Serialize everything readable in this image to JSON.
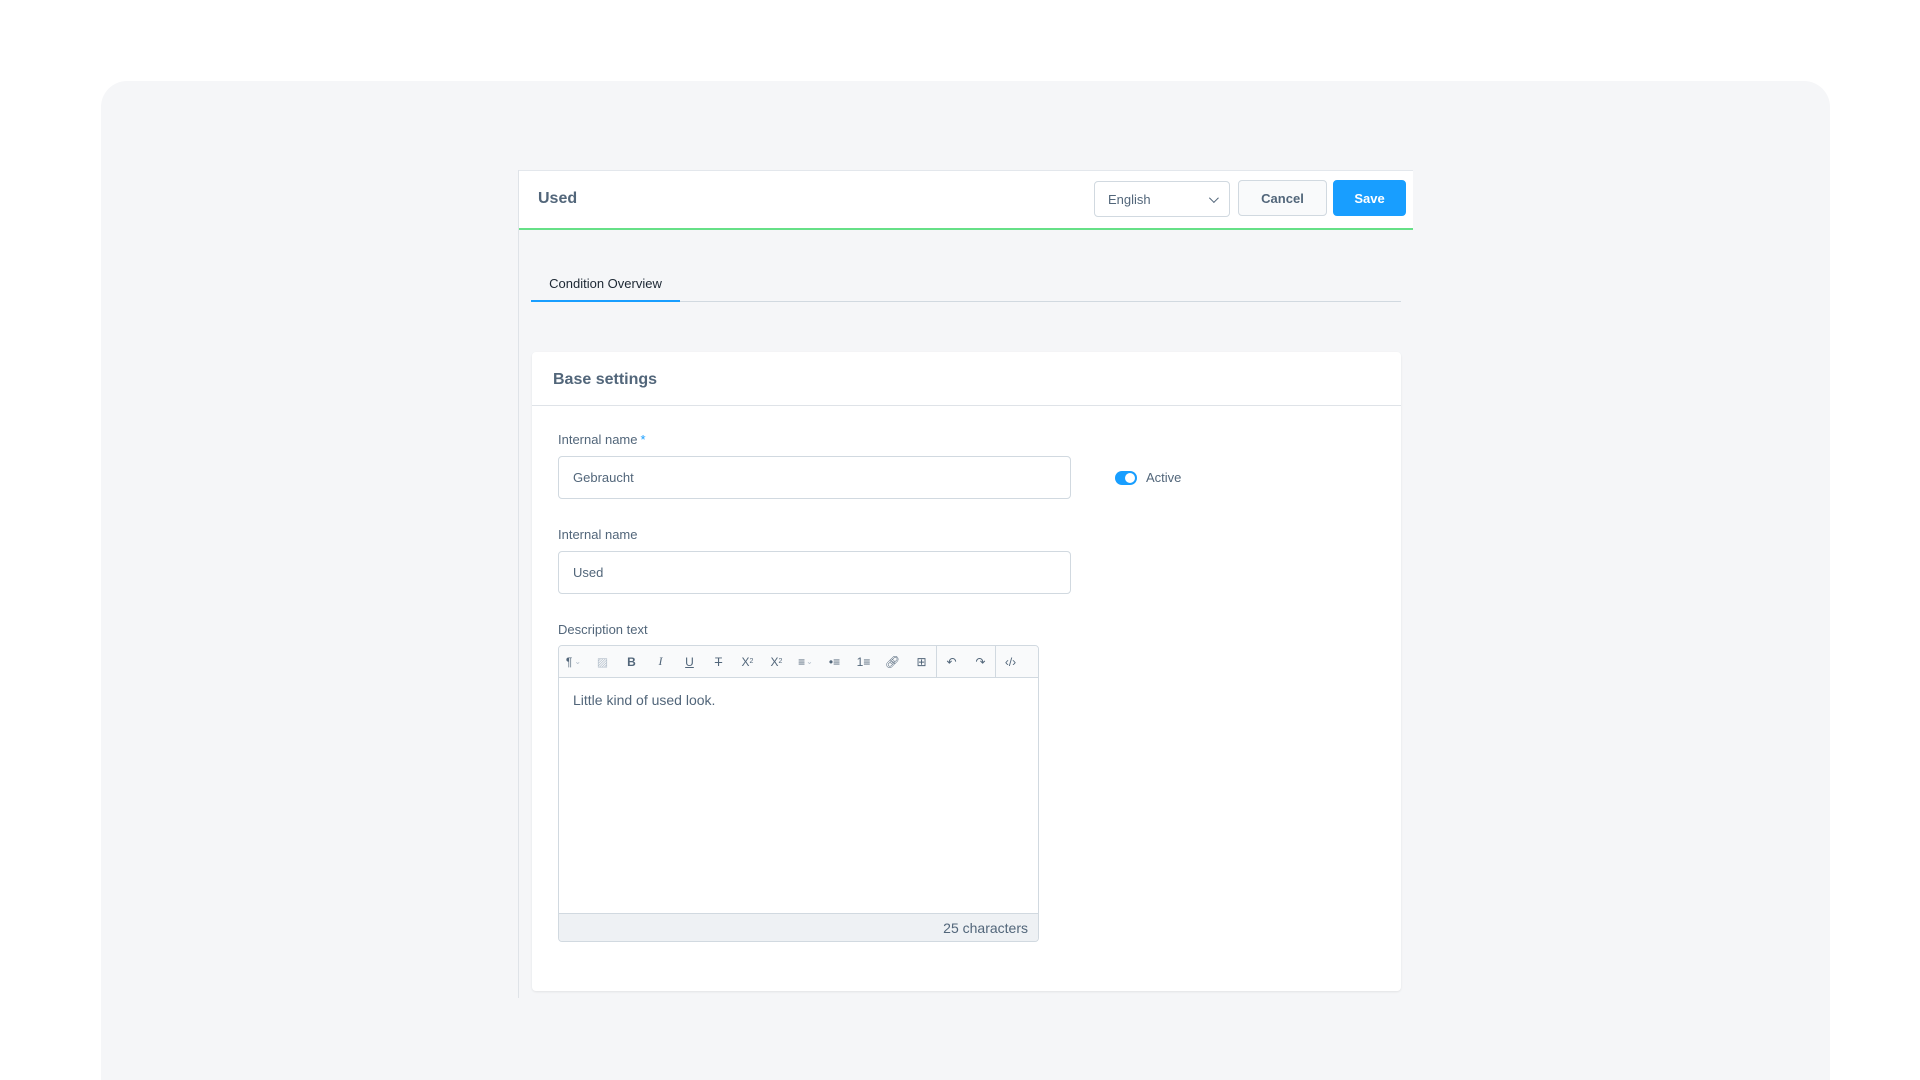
{
  "header": {
    "title": "Used",
    "language": "English",
    "cancel_label": "Cancel",
    "save_label": "Save"
  },
  "tabs": [
    {
      "label": "Condition Overview",
      "active": true
    }
  ],
  "card": {
    "title": "Base settings",
    "fields": {
      "internal_name_1": {
        "label": "Internal name",
        "required_mark": "*",
        "value": "Gebraucht"
      },
      "internal_name_2": {
        "label": "Internal name",
        "value": "Used"
      },
      "active": {
        "label": "Active",
        "on": true
      },
      "description": {
        "label": "Description text",
        "value": "Little kind of used look.",
        "char_count": "25 characters"
      }
    }
  },
  "toolbar_icons": [
    "paragraph-icon",
    "clear-format-icon",
    "bold-icon",
    "italic-icon",
    "underline-icon",
    "strikethrough-icon",
    "superscript-icon",
    "subscript-icon",
    "align-icon",
    "bullet-list-icon",
    "numbered-list-icon",
    "link-icon",
    "table-icon",
    "undo-icon",
    "redo-icon",
    "code-view-icon"
  ],
  "colors": {
    "accent": "#189eff",
    "header_border": "#66e087"
  }
}
